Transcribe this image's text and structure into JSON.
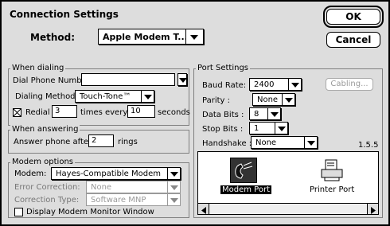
{
  "window": {
    "title": "Connection Settings",
    "ok_label": "OK",
    "cancel_label": "Cancel"
  },
  "method": {
    "label": "Method:",
    "value": "Apple Modem T..."
  },
  "dialing": {
    "group_title": "When dialing",
    "phone_label": "Dial Phone Number",
    "phone_value": "",
    "method_label": "Dialing Method:",
    "method_value": "Touch-Tone™",
    "redial_label": "Redial",
    "redial_checked": true,
    "redial_value": "3",
    "every_label": "times every",
    "every_value": "10",
    "seconds_label": "seconds"
  },
  "answering": {
    "group_title": "When answering",
    "answer_label": "Answer phone after",
    "answer_value": "2",
    "rings_label": "rings"
  },
  "modem": {
    "group_title": "Modem options",
    "modem_label": "Modem:",
    "modem_value": "Hayes-Compatible Modem",
    "error_label": "Error Correction:",
    "error_value": "None",
    "correction_type_label": "Correction Type:",
    "correction_type_value": "Software MNP",
    "monitor_label": "Display Modem Monitor Window",
    "monitor_checked": false
  },
  "port": {
    "group_title": "Port Settings",
    "baud_label": "Baud Rate:",
    "baud_value": "2400",
    "cabling_label": "Cabling...",
    "parity_label": "Parity :",
    "parity_value": "None",
    "databits_label": "Data Bits :",
    "databits_value": "8",
    "stopbits_label": "Stop Bits :",
    "stopbits_value": "1",
    "handshake_label": "Handshake :",
    "handshake_value": "None",
    "version": "1.5.5",
    "ports": [
      {
        "label": "Modem Port",
        "icon": "telephone-icon",
        "selected": true
      },
      {
        "label": "Printer Port",
        "icon": "printer-icon",
        "selected": false
      }
    ]
  }
}
